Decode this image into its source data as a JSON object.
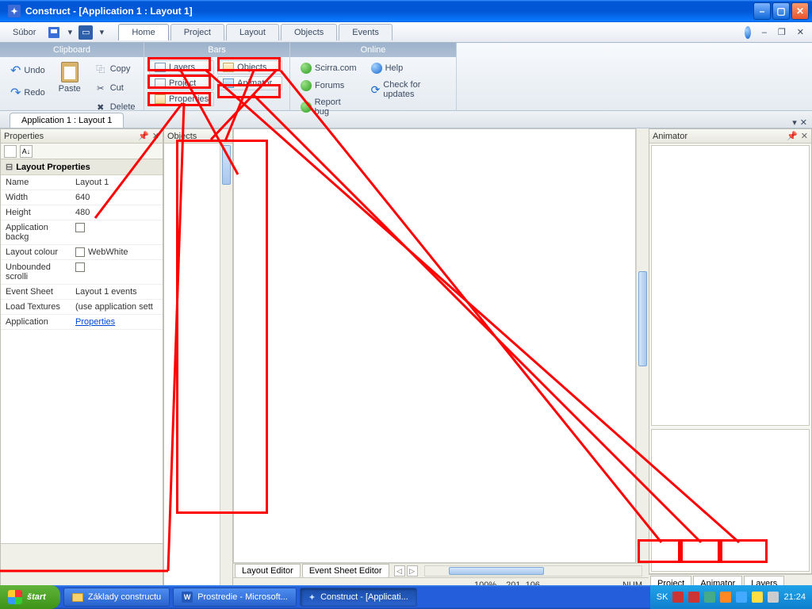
{
  "title": "Construct - [Application 1 : Layout 1]",
  "menu": {
    "file": "Súbor"
  },
  "tabs": {
    "home": "Home",
    "project": "Project",
    "layout": "Layout",
    "objects": "Objects",
    "events": "Events"
  },
  "ribbon": {
    "clipboard": {
      "title": "Clipboard",
      "undo": "Undo",
      "redo": "Redo",
      "paste": "Paste",
      "copy": "Copy",
      "cut": "Cut",
      "delete": "Delete"
    },
    "bars": {
      "title": "Bars",
      "layers": "Layers",
      "project": "Project",
      "properties": "Properties",
      "objects": "Objects",
      "animator": "Animator"
    },
    "online": {
      "title": "Online",
      "scirra": "Scirra.com",
      "forums": "Forums",
      "report": "Report bug",
      "help": "Help",
      "check": "Check for updates"
    }
  },
  "doctab": "Application 1 : Layout 1",
  "panels": {
    "properties": "Properties",
    "objects": "Objects",
    "animator": "Animator"
  },
  "propgrid": {
    "header": "Layout Properties",
    "rows": {
      "name_k": "Name",
      "name_v": "Layout 1",
      "width_k": "Width",
      "width_v": "640",
      "height_k": "Height",
      "height_v": "480",
      "appbg_k": "Application backg",
      "laycol_k": "Layout colour",
      "laycol_v": "WebWhite",
      "unb_k": "Unbounded scrolli",
      "evsh_k": "Event Sheet",
      "evsh_v": "Layout 1 events",
      "loadt_k": "Load Textures",
      "loadt_v": "(use application sett",
      "app_k": "Application",
      "app_v": "Properties"
    }
  },
  "editors": {
    "layout": "Layout Editor",
    "event": "Event Sheet Editor"
  },
  "status": {
    "zoom": "100%",
    "coords": "201, 106",
    "num": "NUM"
  },
  "bottomtabs": {
    "project": "Project",
    "animator": "Animator",
    "layers": "Layers"
  },
  "taskbar": {
    "start": "štart",
    "t1": "Základy constructu",
    "t2": "Prostredie - Microsoft...",
    "t3": "Construct - [Applicati...",
    "lang": "SK",
    "clock": "21:24"
  }
}
